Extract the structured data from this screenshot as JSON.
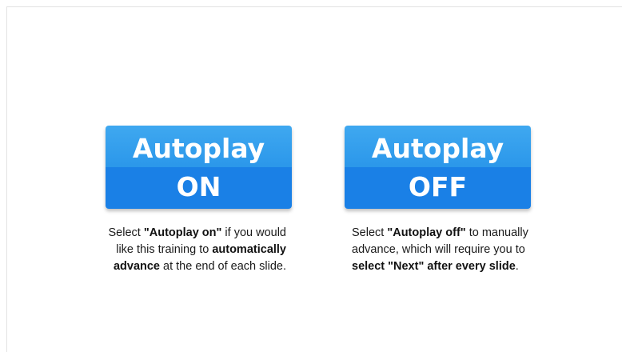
{
  "autoplay_on": {
    "line1": "Autoplay",
    "line2": "ON",
    "desc": [
      {
        "t": "Select ",
        "b": false
      },
      {
        "t": "\"Autoplay on\"",
        "b": true
      },
      {
        "t": " if you would like this training to ",
        "b": false
      },
      {
        "t": "automatically advance",
        "b": true
      },
      {
        "t": " at the end of each slide.",
        "b": false
      }
    ]
  },
  "autoplay_off": {
    "line1": "Autoplay",
    "line2": "OFF",
    "desc": [
      {
        "t": "Select ",
        "b": false
      },
      {
        "t": "\"Autoplay off\"",
        "b": true
      },
      {
        "t": " to manually advance, which will require you to ",
        "b": false
      },
      {
        "t": "select \"Next\" after every slide",
        "b": true
      },
      {
        "t": ".",
        "b": false
      }
    ]
  },
  "colors": {
    "button_top": "#2b97ea",
    "button_bottom": "#1a80e6",
    "button_text": "#ffffff"
  }
}
